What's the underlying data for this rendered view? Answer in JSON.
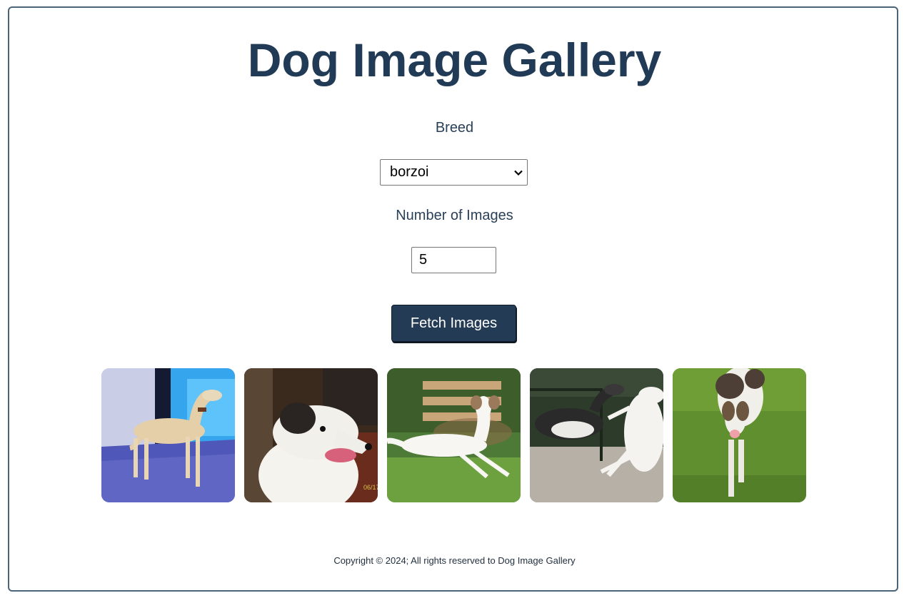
{
  "header": {
    "title": "Dog Image Gallery"
  },
  "form": {
    "breed_label": "Breed",
    "breed_selected": "borzoi",
    "count_label": "Number of Images",
    "count_value": "5",
    "fetch_label": "Fetch Images"
  },
  "gallery": {
    "images": [
      {
        "breed": "borzoi",
        "alt": "borzoi"
      },
      {
        "breed": "borzoi",
        "alt": "borzoi",
        "stamp": "06/17"
      },
      {
        "breed": "borzoi",
        "alt": "borzoi"
      },
      {
        "breed": "borzoi",
        "alt": "borzoi"
      },
      {
        "breed": "borzoi",
        "alt": "borzoi"
      }
    ]
  },
  "footer": {
    "text": "Copyright © 2024; All rights reserved to Dog Image Gallery"
  },
  "colors": {
    "primary": "#243b55",
    "border": "#4a6478"
  }
}
